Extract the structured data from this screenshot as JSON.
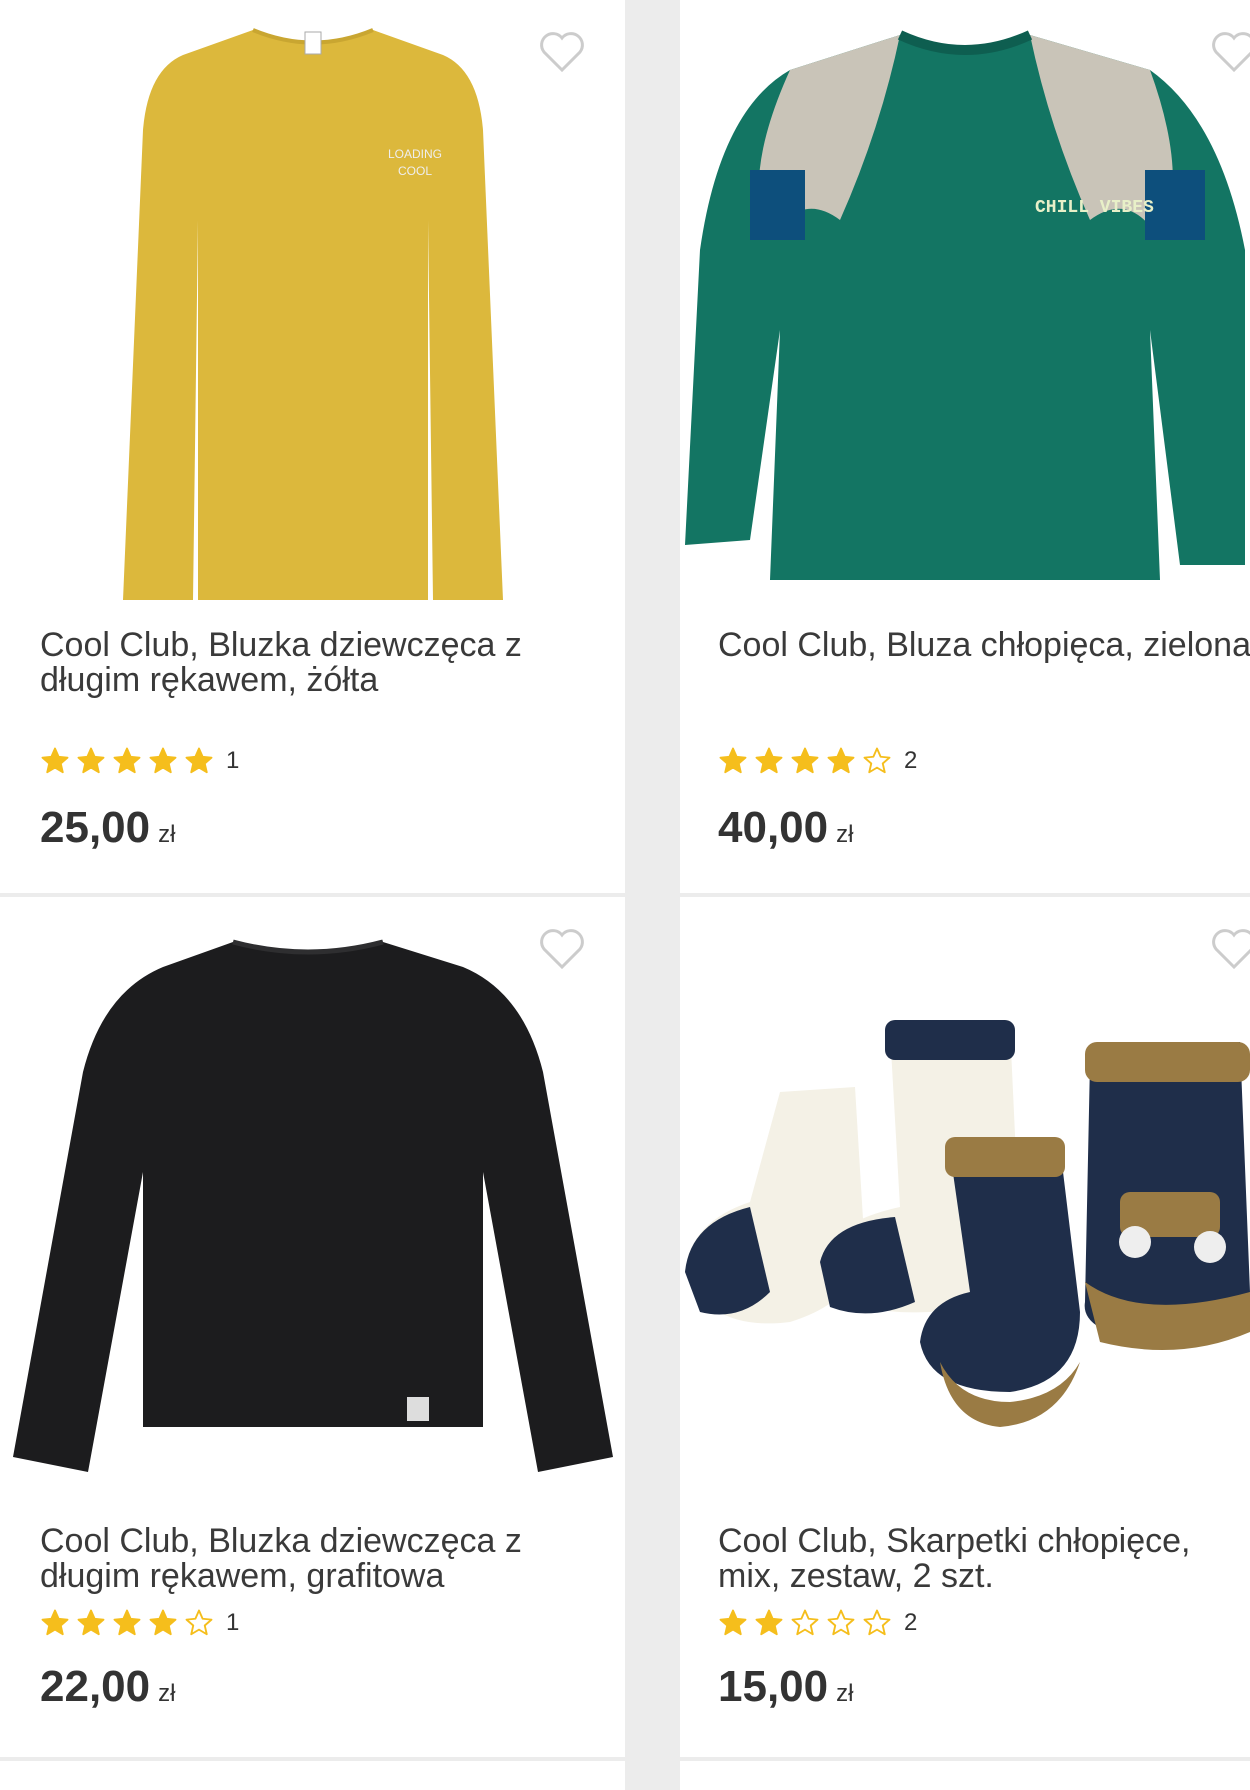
{
  "products": [
    {
      "title": "Cool Club, Bluzka dziewczęca z długim rękawem, żółta",
      "rating_filled": 5,
      "rating_count": "1",
      "price": "25,00",
      "currency": "zł",
      "image_color": "#dcb83c",
      "image_kind": "shirt-yellow"
    },
    {
      "title": "Cool Club, Bluza chłopięca, zielona",
      "rating_filled": 4,
      "rating_count": "2",
      "price": "40,00",
      "currency": "zł",
      "image_color": "#137563",
      "image_kind": "sweatshirt-green",
      "print_text": "CHILL VIBES"
    },
    {
      "title": "Cool Club, Bluzka dziewczęca z długim rękawem, grafitowa",
      "rating_filled": 4,
      "rating_count": "1",
      "price": "22,00",
      "currency": "zł",
      "image_color": "#1c1c1e",
      "image_kind": "shirt-black"
    },
    {
      "title": "Cool Club, Skarpetki chłopięce, mix, zestaw, 2 szt.",
      "rating_filled": 2,
      "rating_count": "2",
      "price": "15,00",
      "currency": "zł",
      "image_color": "#1f2e4a",
      "image_kind": "socks"
    }
  ],
  "colors": {
    "star_filled": "#f5be1c",
    "star_empty_stroke": "#f5be1c",
    "heart_stroke": "#cccccc"
  }
}
